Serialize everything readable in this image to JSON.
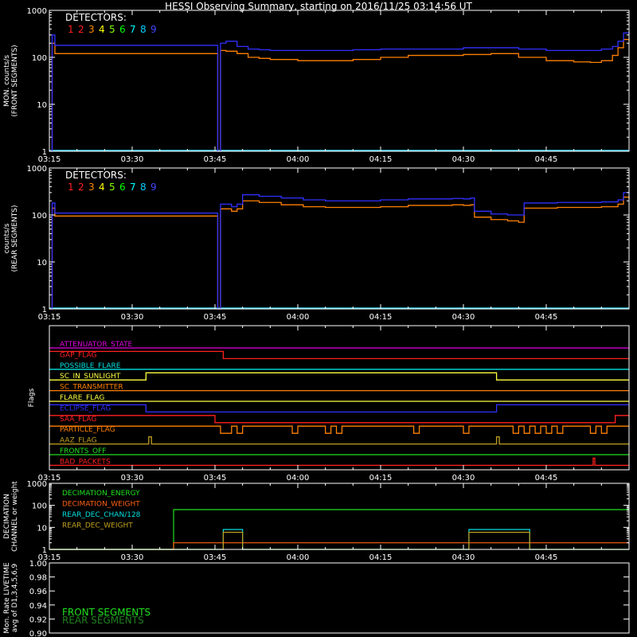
{
  "title": "HESSI Observing Summary, starting on 2016/11/25 03:14:56 UT",
  "colors": {
    "background": "#000000",
    "axis": "#ffffff",
    "det1": "#ff2020",
    "det2": "#ff2020",
    "det3": "#ff8800",
    "det4": "#ffff00",
    "det5": "#80ff00",
    "det6": "#00ff00",
    "det7": "#00ffff",
    "det8": "#00d0ff",
    "det9": "#4444ff",
    "front_curve": "#3030ff",
    "rear_curve": "#ff8000",
    "curve_base": "#40e0ff"
  },
  "chart_data": [
    {
      "id": "front",
      "type": "line",
      "ylabel": [
        "MON. counts/s",
        "(FRONT SEGMENTS)"
      ],
      "yscale": "log",
      "ylim": [
        1,
        1000
      ],
      "yticks": [
        "1",
        "10",
        "100",
        "1000"
      ],
      "xlim_minutes": [
        0,
        105
      ],
      "xticks": [
        "03:15",
        "03:30",
        "03:45",
        "04:00",
        "04:15",
        "04:30",
        "04:45"
      ],
      "legend_title": "DETECTORS:",
      "legend_numbers": [
        "1",
        "2",
        "3",
        "4",
        "5",
        "6",
        "7",
        "8",
        "9"
      ],
      "series": [
        {
          "key": "blue",
          "color": "#3030ff",
          "x": [
            0,
            0.5,
            1,
            30.5,
            31,
            32,
            34,
            36,
            38,
            40,
            45,
            50,
            55,
            60,
            65,
            70,
            75,
            80,
            85,
            90,
            95,
            98,
            100,
            102,
            103,
            104,
            105
          ],
          "y": [
            1,
            300,
            180,
            1,
            200,
            220,
            170,
            150,
            145,
            140,
            140,
            140,
            145,
            150,
            150,
            150,
            160,
            160,
            150,
            140,
            140,
            140,
            150,
            170,
            220,
            330,
            300
          ]
        },
        {
          "key": "orange",
          "color": "#ff8000",
          "x": [
            0,
            0.5,
            1,
            30.5,
            31,
            32,
            34,
            36,
            38,
            40,
            45,
            50,
            55,
            60,
            65,
            70,
            75,
            80,
            85,
            90,
            95,
            98,
            100,
            102,
            103,
            104,
            105
          ],
          "y": [
            1,
            200,
            120,
            1,
            140,
            135,
            120,
            100,
            95,
            90,
            85,
            85,
            90,
            100,
            110,
            110,
            115,
            120,
            100,
            85,
            80,
            78,
            85,
            110,
            160,
            240,
            220
          ]
        }
      ]
    },
    {
      "id": "rear",
      "type": "line",
      "ylabel": [
        "counts/s",
        "(REAR SEGMENTS)"
      ],
      "yscale": "log",
      "ylim": [
        1,
        1000
      ],
      "yticks": [
        "1",
        "10",
        "100",
        "1000"
      ],
      "xlim_minutes": [
        0,
        105
      ],
      "xticks": [
        "03:15",
        "03:30",
        "03:45",
        "04:00",
        "04:15",
        "04:30",
        "04:45"
      ],
      "legend_title": "DETECTORS:",
      "legend_numbers": [
        "1",
        "2",
        "3",
        "4",
        "5",
        "6",
        "7",
        "8",
        "9"
      ],
      "series": [
        {
          "key": "blue",
          "color": "#3030ff",
          "x": [
            0,
            0.5,
            1,
            30.5,
            31,
            33,
            34,
            35,
            38,
            42,
            46,
            50,
            55,
            60,
            65,
            70,
            73,
            75,
            76.3,
            77,
            80,
            83,
            85,
            86,
            88,
            92,
            96,
            100,
            103,
            104,
            105
          ],
          "y": [
            1,
            180,
            110,
            1,
            170,
            150,
            170,
            270,
            250,
            230,
            210,
            200,
            200,
            210,
            220,
            220,
            225,
            220,
            230,
            120,
            105,
            100,
            100,
            180,
            180,
            185,
            185,
            190,
            210,
            300,
            280
          ]
        },
        {
          "key": "orange",
          "color": "#ff8000",
          "x": [
            0,
            0.5,
            1,
            30.5,
            31,
            33,
            34,
            35,
            38,
            42,
            46,
            50,
            55,
            60,
            65,
            70,
            73,
            75,
            76.3,
            77,
            80,
            83,
            85,
            86,
            88,
            92,
            96,
            100,
            103,
            104,
            105
          ],
          "y": [
            1,
            140,
            95,
            1,
            135,
            120,
            135,
            200,
            185,
            165,
            150,
            145,
            145,
            150,
            160,
            160,
            165,
            160,
            165,
            90,
            80,
            75,
            70,
            140,
            140,
            145,
            145,
            150,
            170,
            240,
            220
          ]
        }
      ]
    },
    {
      "id": "flags",
      "type": "flags",
      "ylabel": "Flags",
      "xlim_minutes": [
        0,
        105
      ],
      "xticks": [
        "03:15",
        "03:30",
        "03:45",
        "04:00",
        "04:15",
        "04:30",
        "04:45"
      ],
      "rows": [
        {
          "label": "ATTENUATOR_STATE",
          "color": "#e000e0",
          "levels": [
            [
              0,
              105,
              0
            ]
          ]
        },
        {
          "label": "GAP_FLAG",
          "color": "#ff2020",
          "levels": [
            [
              0,
              31.5,
              1
            ],
            [
              31.5,
              105,
              0
            ]
          ]
        },
        {
          "label": "POSSIBLE_FLARE",
          "color": "#00e0e0",
          "levels": [
            [
              0,
              105,
              0
            ]
          ]
        },
        {
          "label": "SC_IN_SUNLIGHT",
          "color": "#ffff40",
          "levels": [
            [
              0,
              17.5,
              0
            ],
            [
              17.5,
              81,
              1
            ],
            [
              81,
              105,
              0
            ]
          ]
        },
        {
          "label": "SC_TRANSMITTER",
          "color": "#ff8000",
          "levels": [
            [
              0,
              105,
              0
            ]
          ]
        },
        {
          "label": "FLARE_FLAG",
          "color": "#ffff40",
          "levels": [
            [
              0,
              105,
              0
            ]
          ]
        },
        {
          "label": "ECLIPSE_FLAG",
          "color": "#3030ff",
          "levels": [
            [
              0,
              17.5,
              1
            ],
            [
              17.5,
              81,
              0
            ],
            [
              81,
              105,
              1
            ]
          ]
        },
        {
          "label": "SAA_FLAG",
          "color": "#ff2020",
          "levels": [
            [
              0,
              30,
              1
            ],
            [
              30,
              102.5,
              0
            ],
            [
              102.5,
              105,
              1
            ]
          ]
        },
        {
          "label": "PARTICLE_FLAG",
          "color": "#ff8000",
          "levels": [
            [
              0,
              31,
              1
            ],
            [
              31,
              33,
              0
            ],
            [
              33,
              34,
              1
            ],
            [
              34,
              35,
              0
            ],
            [
              35,
              44,
              1
            ],
            [
              44,
              45,
              0
            ],
            [
              45,
              50,
              1
            ],
            [
              50,
              51,
              0
            ],
            [
              51,
              52,
              1
            ],
            [
              52,
              53,
              0
            ],
            [
              53,
              66,
              1
            ],
            [
              66,
              67,
              0
            ],
            [
              67,
              75,
              1
            ],
            [
              75,
              76,
              0
            ],
            [
              76,
              84,
              1
            ],
            [
              84,
              85,
              0
            ],
            [
              85,
              86,
              1
            ],
            [
              86,
              87,
              0
            ],
            [
              87,
              88,
              1
            ],
            [
              88,
              89,
              0
            ],
            [
              89,
              90,
              1
            ],
            [
              90,
              91,
              0
            ],
            [
              91,
              92,
              1
            ],
            [
              92,
              93,
              0
            ],
            [
              93,
              98,
              1
            ],
            [
              98,
              99,
              0
            ],
            [
              99,
              100,
              1
            ],
            [
              100,
              101,
              0
            ],
            [
              101,
              105,
              1
            ]
          ]
        },
        {
          "label": "AAZ_FLAG",
          "color": "#c0a020",
          "levels": [
            [
              0,
              18,
              0
            ],
            [
              18,
              18.5,
              1
            ],
            [
              18.5,
              81,
              0
            ],
            [
              81,
              81.5,
              1
            ],
            [
              81.5,
              105,
              0
            ]
          ]
        },
        {
          "label": "FRONTS_OFF",
          "color": "#20e020",
          "levels": [
            [
              0,
              105,
              0
            ]
          ]
        },
        {
          "label": "BAD_PACKETS",
          "color": "#ff2020",
          "levels": [
            [
              0,
              98.5,
              0
            ],
            [
              98.5,
              98.8,
              1
            ],
            [
              98.8,
              105,
              0
            ]
          ]
        }
      ]
    },
    {
      "id": "decimation",
      "type": "line",
      "ylabel": [
        "DECIMATION",
        "CHANNEL or weight"
      ],
      "yscale": "log",
      "ylim": [
        1,
        1000
      ],
      "yticks": [
        "1",
        "10",
        "100",
        "1000"
      ],
      "xlim_minutes": [
        0,
        105
      ],
      "xticks": [
        "03:15",
        "03:30",
        "03:45",
        "04:00",
        "04:15",
        "04:30",
        "04:45"
      ],
      "legend": [
        {
          "label": "DECIMATION_ENERGY",
          "color": "#20e020"
        },
        {
          "label": "DECIMATION_WEIGHT",
          "color": "#ff6010"
        },
        {
          "label": "REAR_DEC_CHAN/128",
          "color": "#00e0e0"
        },
        {
          "label": "REAR_DEC_WEIGHT",
          "color": "#c0a020"
        }
      ],
      "series": [
        {
          "key": "energy",
          "color": "#20e020",
          "x": [
            0,
            22.5,
            22.5,
            105
          ],
          "y": [
            1,
            1,
            64,
            64
          ]
        },
        {
          "key": "weight",
          "color": "#ff6010",
          "x": [
            0,
            22.5,
            22.5,
            105
          ],
          "y": [
            1,
            1,
            2,
            2
          ]
        },
        {
          "key": "chan",
          "color": "#00e0e0",
          "x": [
            0,
            31.5,
            31.5,
            35,
            35,
            76,
            76,
            87,
            87,
            105
          ],
          "y": [
            1,
            1,
            8,
            8,
            1,
            1,
            8,
            8,
            1,
            1
          ]
        },
        {
          "key": "rwt",
          "color": "#c0a020",
          "x": [
            0,
            31.5,
            31.5,
            35,
            35,
            76,
            76,
            87,
            87,
            105
          ],
          "y": [
            1,
            1,
            6,
            6,
            1,
            1,
            6,
            6,
            1,
            1
          ]
        }
      ]
    },
    {
      "id": "livetime",
      "type": "line",
      "ylabel": [
        "Mon. Rate LIVETIME",
        "avg of D1,3,4,5,6,9"
      ],
      "ylim": [
        0.9,
        1.0
      ],
      "yticks": [
        "0.90",
        "0.92",
        "0.94",
        "0.96",
        "0.98",
        "1.00"
      ],
      "legend": [
        {
          "label": "FRONT SEGMENTS",
          "color": "#20e020"
        },
        {
          "label": "REAR SEGMENTS",
          "color": "#208020"
        }
      ],
      "series": []
    }
  ]
}
